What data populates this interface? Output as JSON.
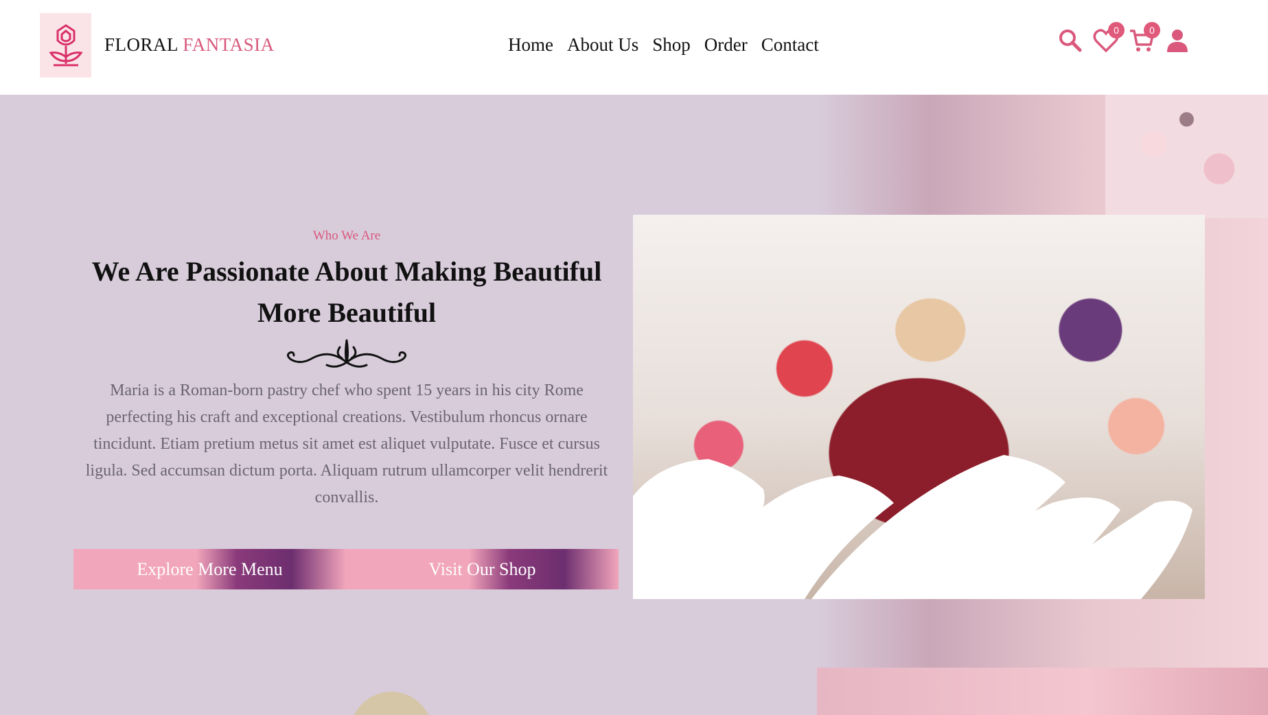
{
  "brand": {
    "name_part1": "FLORAL",
    "name_part2": "FANTASIA"
  },
  "nav": {
    "items": [
      "Home",
      "About Us",
      "Shop",
      "Order",
      "Contact"
    ]
  },
  "header_icons": {
    "wishlist_count": "0",
    "cart_count": "0"
  },
  "hero": {
    "subtitle": "Who We Are",
    "title": "We Are Passionate About Making Beautiful More Beautiful",
    "description": "Maria is a Roman-born pastry chef who spent 15 years in his city Rome perfecting his craft and exceptional creations. Vestibulum rhoncus ornare tincidunt. Etiam pretium metus sit amet est aliquet vulputate. Fusce et cursus ligula. Sed accumsan dictum porta. Aliquam rutrum ullamcorper velit hendrerit convallis.",
    "buttons": {
      "explore": "Explore More Menu",
      "visit": "Visit Our Shop"
    }
  },
  "colors": {
    "accent": "#d9587c",
    "hero_bg": "#d8ccdb",
    "header_bg": "#ffffff"
  }
}
